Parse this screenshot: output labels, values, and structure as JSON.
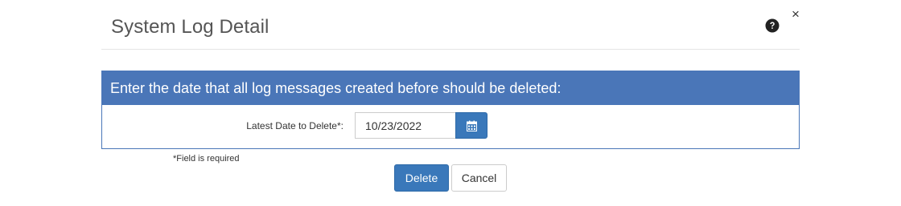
{
  "dialog": {
    "title": "System Log Detail",
    "help_icon": "question-circle-icon",
    "close_icon": "close-icon",
    "close_glyph": "×"
  },
  "panel": {
    "heading": "Enter the date that all log messages created before should be deleted:",
    "field_label": "Latest Date to Delete*:",
    "date_value": "10/23/2022",
    "calendar_icon": "calendar-icon"
  },
  "footer": {
    "required_note": "*Field is required",
    "delete_label": "Delete",
    "cancel_label": "Cancel"
  },
  "colors": {
    "accent": "#4a76b8",
    "button_primary": "#3a78ba",
    "title_text": "#555555"
  }
}
